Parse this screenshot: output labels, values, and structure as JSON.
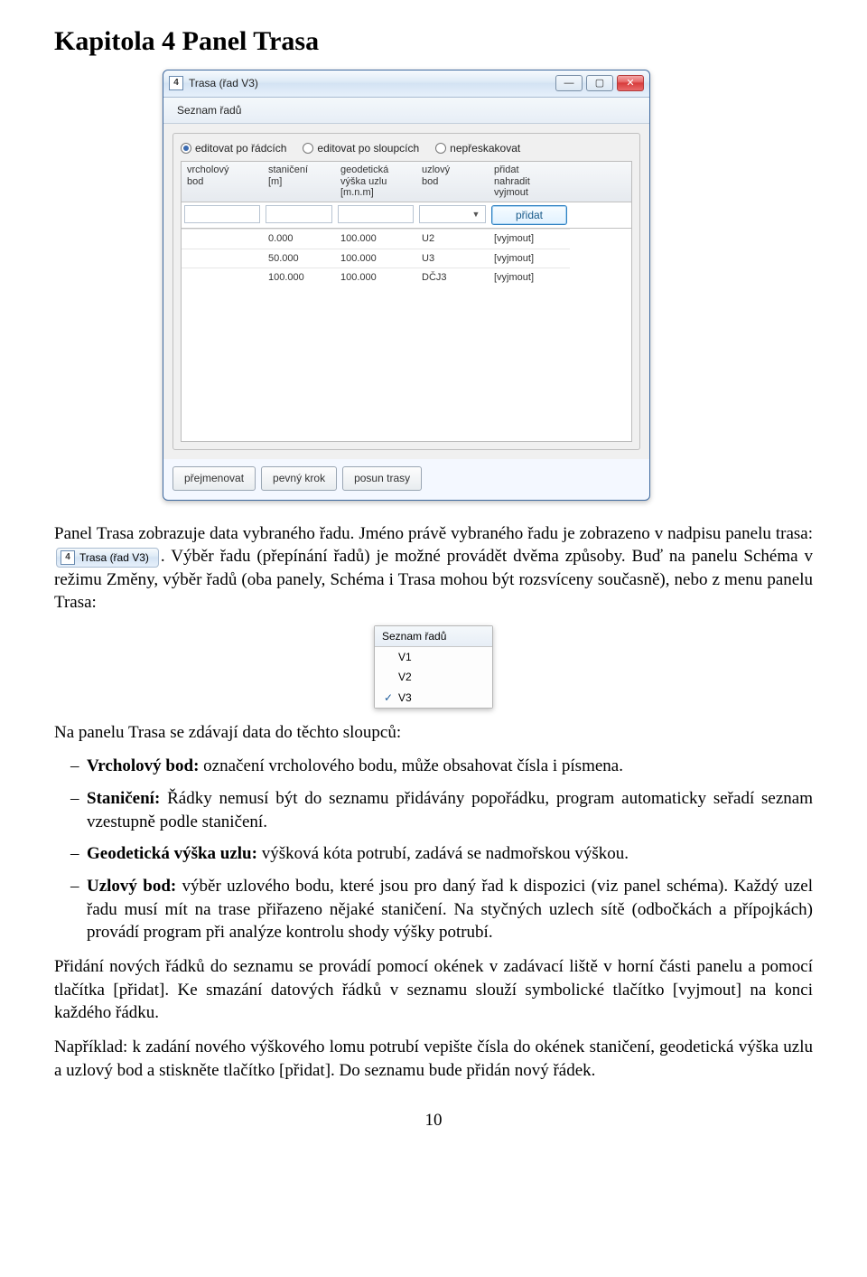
{
  "heading": "Kapitola 4  Panel Trasa",
  "window": {
    "title": "Trasa (řad V3)",
    "icon_glyph": "4",
    "chrome": {
      "min": "—",
      "max": "▢",
      "close": "✕"
    },
    "menu": {
      "seznam": "Seznam řadů"
    },
    "radios": {
      "r1": "editovat po řádcích",
      "r2": "editovat po sloupcích",
      "r3": "nepřeskakovat",
      "selected": 0
    },
    "columns": {
      "c1a": "vrcholový",
      "c1b": "bod",
      "c2a": "staničení",
      "c2b": "[m]",
      "c3a": "geodetická",
      "c3b": "výška uzlu",
      "c3c": "[m.n.m]",
      "c4a": "uzlový",
      "c4b": "bod",
      "c5a": "přidat",
      "c5b": "nahradit",
      "c5c": "vyjmout"
    },
    "add_button": "přidat",
    "rows": [
      {
        "stan": "0.000",
        "vyska": "100.000",
        "uzl": "U2",
        "act": "[vyjmout]"
      },
      {
        "stan": "50.000",
        "vyska": "100.000",
        "uzl": "U3",
        "act": "[vyjmout]"
      },
      {
        "stan": "100.000",
        "vyska": "100.000",
        "uzl": "DČJ3",
        "act": "[vyjmout]"
      }
    ],
    "bottom_buttons": {
      "b1": "přejmenovat",
      "b2": "pevný krok",
      "b3": "posun trasy"
    }
  },
  "body": {
    "p1a": "Panel Trasa zobrazuje data vybraného řadu. Jméno právě vybraného řadu je zobrazeno v nadpisu panelu trasa: ",
    "badge_text": "Trasa (řad V3)",
    "p1b": ". Výběr řadu (přepínání řadů) je možné provádět dvěma způsoby. Buď na panelu Schéma v režimu Změny, výběr řadů (oba panely, Schéma i Trasa mohou být rozsvíceny současně), nebo z menu panelu Trasa:",
    "dropdown": {
      "header": "Seznam řadů",
      "o1": "V1",
      "o2": "V2",
      "o3": "V3",
      "checked": 2
    },
    "p2": "Na panelu Trasa se zdávají data do těchto sloupců:",
    "bullets": {
      "b1_label": "Vrcholový bod:",
      "b1_rest": " označení vrcholového bodu, může obsahovat čísla i písmena.",
      "b2_label": "Staničení:",
      "b2_rest": " Řádky nemusí být do seznamu přidávány popořádku, program automaticky seřadí seznam vzestupně podle staničení.",
      "b3_label": "Geodetická výška uzlu:",
      "b3_rest": " výšková kóta potrubí, zadává se nadmořskou výškou.",
      "b4_label": "Uzlový bod:",
      "b4_rest": " výběr uzlového bodu, které jsou pro daný řad k dispozici (viz panel schéma). Každý uzel řadu musí mít na trase přiřazeno nějaké staničení. Na styčných uzlech sítě (odbočkách a přípojkách) provádí program při analýze kontrolu shody výšky potrubí."
    },
    "p3": "Přidání nových řádků do seznamu se provádí pomocí okének v zadávací liště v horní části panelu a pomocí tlačítka [přidat]. Ke smazání datových řádků v seznamu slouží symbolické tlačítko [vyjmout] na konci každého řádku.",
    "p4": "Například: k zadání nového výškového lomu potrubí vepište čísla do okének staničení, geodetická výška uzlu a uzlový bod a stiskněte tlačítko [přidat]. Do seznamu bude přidán nový řádek."
  },
  "page_number": "10"
}
